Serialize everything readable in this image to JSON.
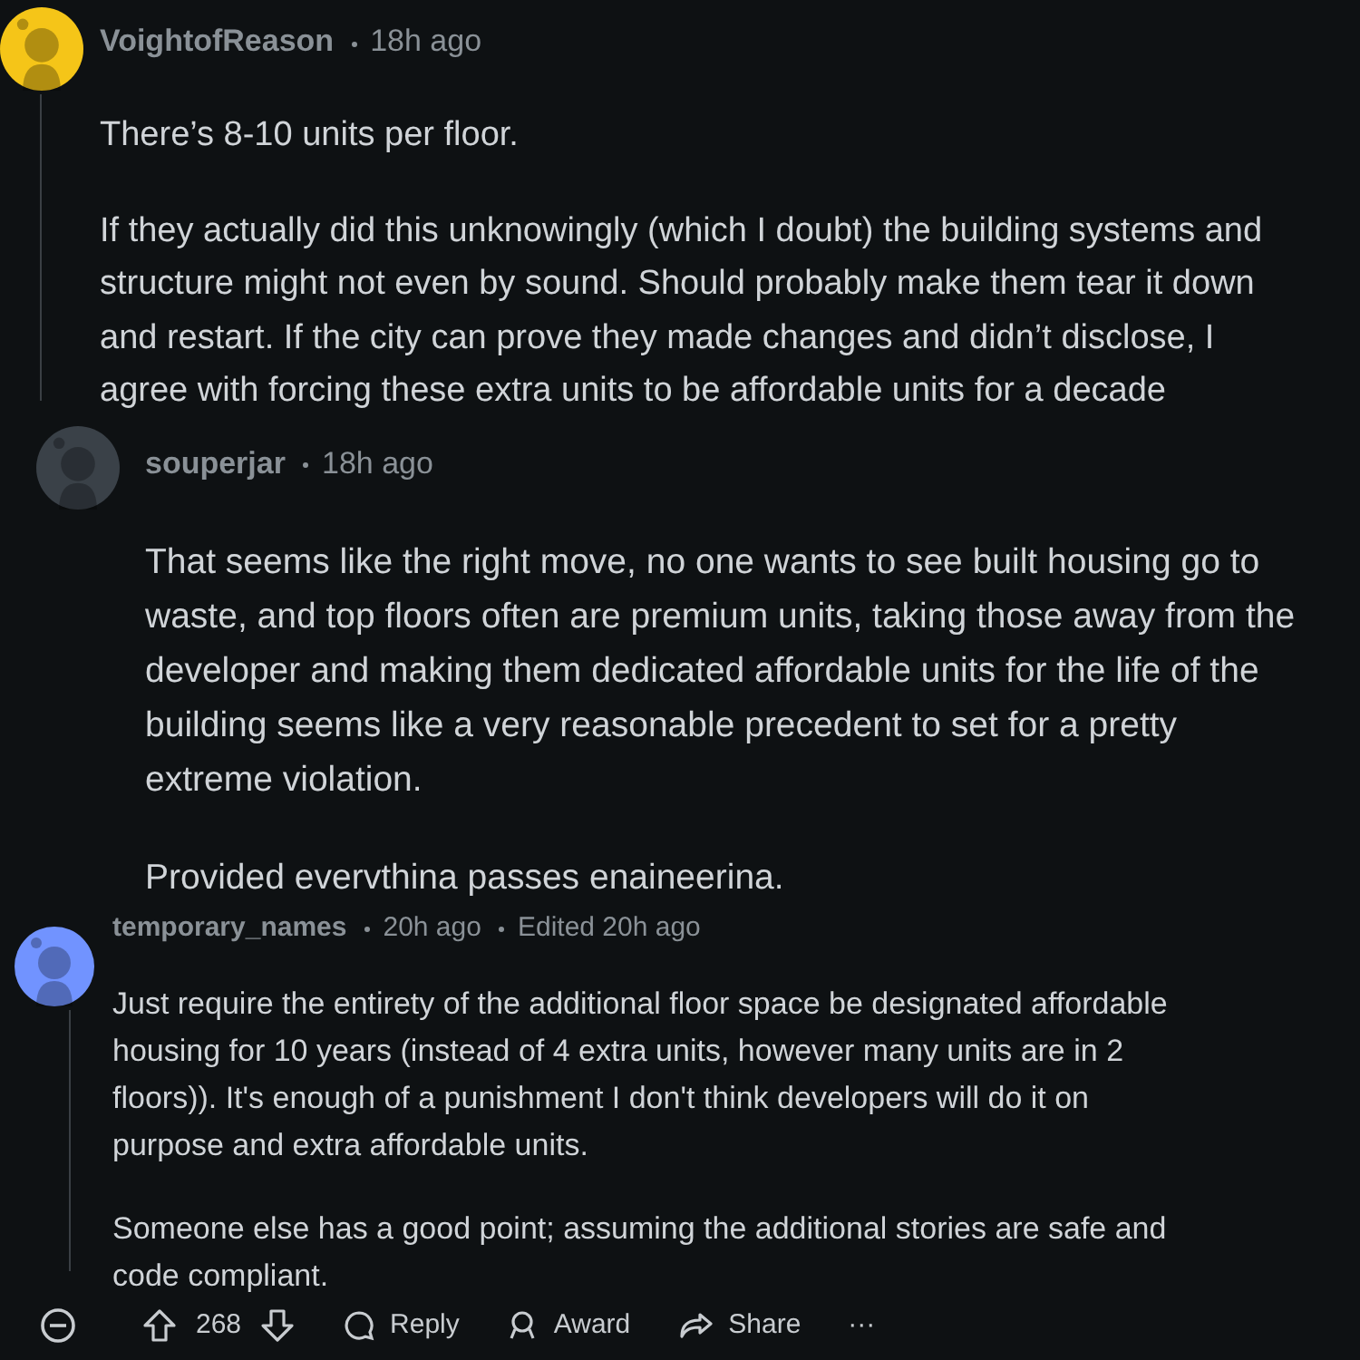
{
  "comments": [
    {
      "author": "VoightofReason",
      "time": "18h ago",
      "paragraphs": [
        "There’s 8-10 units per floor.",
        "If they actually did this unknowingly (which I doubt) the building systems and structure might not even by sound. Should probably make them tear it down and restart. If the city can prove they made changes and didn’t disclose, I agree with forcing these extra units to be affordable units for a decade"
      ]
    },
    {
      "author": "souperjar",
      "time": "18h ago",
      "paragraphs": [
        "That seems like the right move, no one wants to see built housing go to waste, and top floors often are premium units, taking those away from the developer and making them dedicated affordable units for the life of the building seems like a very reasonable precedent to set for a pretty extreme violation.",
        "Provided evervthina passes enaineerina."
      ]
    },
    {
      "author": "temporary_names",
      "time": "20h ago",
      "edited": "Edited 20h ago",
      "paragraphs": [
        "Just require the entirety of the additional floor space be designated affordable housing for 10 years (instead of 4 extra units, however many units are in 2 floors)). It's enough of a punishment I don't think developers will do it on purpose and extra affordable units.",
        "Someone else has a good point; assuming the additional stories are safe and code compliant."
      ],
      "actions": {
        "score": "268",
        "reply": "Reply",
        "award": "Award",
        "share": "Share",
        "more": "···"
      }
    }
  ]
}
